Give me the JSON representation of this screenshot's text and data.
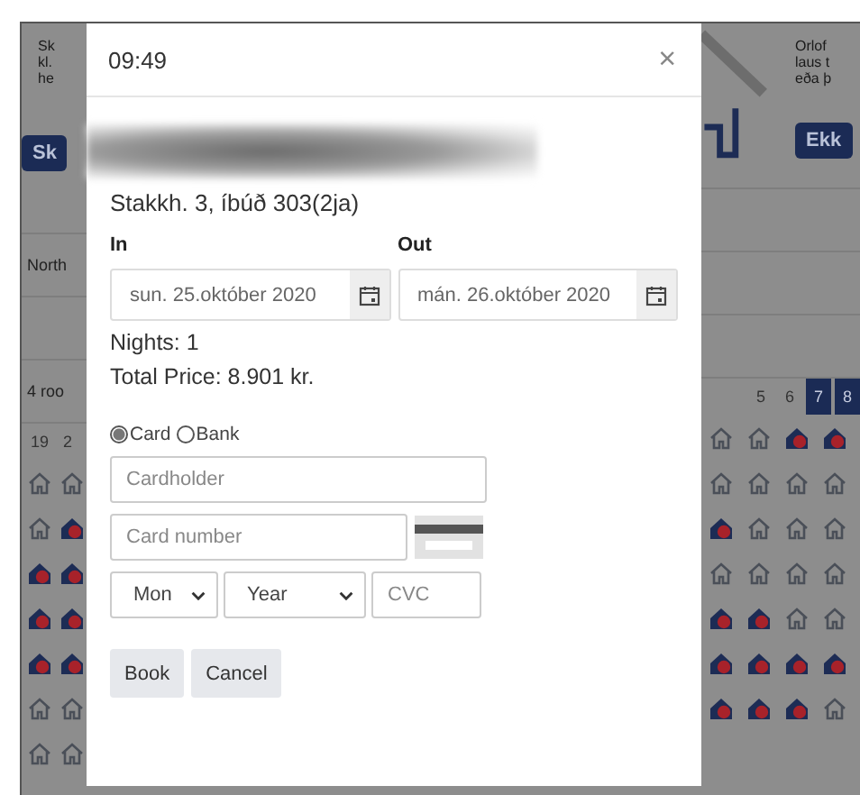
{
  "background": {
    "left_notice": [
      "Sk",
      "kl.",
      "he"
    ],
    "left_button": "Sk",
    "left_label": "North",
    "left_rooms": "4 roo",
    "left_days": [
      {
        "label": "19",
        "selected": false
      },
      {
        "label": "2",
        "selected": false
      }
    ],
    "right_notice": [
      "Orlof",
      "laus t",
      "eða þ"
    ],
    "right_button": "Ekk",
    "right_days": [
      {
        "label": "5",
        "selected": false
      },
      {
        "label": "6",
        "selected": false
      },
      {
        "label": "7",
        "selected": true
      },
      {
        "label": "8",
        "selected": true
      }
    ],
    "house_rows": [
      {
        "left": [
          {
            "kind": "free"
          },
          {
            "kind": "free"
          }
        ],
        "right": [
          {
            "kind": "free"
          },
          {
            "kind": "free"
          },
          {
            "kind": "booked"
          },
          {
            "kind": "booked"
          }
        ]
      },
      {
        "left": [
          {
            "kind": "free"
          },
          {
            "kind": "booked"
          }
        ],
        "right": [
          {
            "kind": "free"
          },
          {
            "kind": "free"
          },
          {
            "kind": "free"
          },
          {
            "kind": "free"
          }
        ]
      },
      {
        "left": [
          {
            "kind": "booked"
          },
          {
            "kind": "booked"
          }
        ],
        "right": [
          {
            "kind": "booked"
          },
          {
            "kind": "free"
          },
          {
            "kind": "free"
          },
          {
            "kind": "free"
          }
        ]
      },
      {
        "left": [
          {
            "kind": "booked"
          },
          {
            "kind": "booked"
          }
        ],
        "right": [
          {
            "kind": "free"
          },
          {
            "kind": "free"
          },
          {
            "kind": "free"
          },
          {
            "kind": "free"
          }
        ]
      },
      {
        "left": [
          {
            "kind": "booked"
          },
          {
            "kind": "booked"
          }
        ],
        "right": [
          {
            "kind": "booked"
          },
          {
            "kind": "booked"
          },
          {
            "kind": "free"
          },
          {
            "kind": "free"
          }
        ]
      },
      {
        "left": [
          {
            "kind": "free"
          },
          {
            "kind": "free"
          }
        ],
        "right": [
          {
            "kind": "booked"
          },
          {
            "kind": "booked"
          },
          {
            "kind": "booked"
          },
          {
            "kind": "booked"
          }
        ]
      },
      {
        "left": [
          {
            "kind": "free"
          },
          {
            "kind": "free"
          }
        ],
        "right": [
          {
            "kind": "booked"
          },
          {
            "kind": "booked"
          },
          {
            "kind": "booked"
          },
          {
            "kind": "free"
          }
        ]
      }
    ]
  },
  "modal": {
    "title": "09:49",
    "close": "×",
    "subtitle": "Stakkh. 3, íbúð 303(2ja)",
    "checkin": {
      "label": "In",
      "value": "sun. 25.október 2020"
    },
    "checkout": {
      "label": "Out",
      "value": "mán. 26.október 2020"
    },
    "nights": "Nights: 1",
    "total": "Total Price: 8.901 kr.",
    "payment_options": [
      {
        "label": "Card",
        "selected": true
      },
      {
        "label": "Bank",
        "selected": false
      }
    ],
    "cardholder": {
      "placeholder": "Cardholder"
    },
    "card_number": {
      "placeholder": "Card number"
    },
    "month": {
      "value": "Mon"
    },
    "year": {
      "value": "Year"
    },
    "cvc": {
      "placeholder": "CVC"
    },
    "buttons": [
      "Book",
      "Cancel"
    ]
  }
}
